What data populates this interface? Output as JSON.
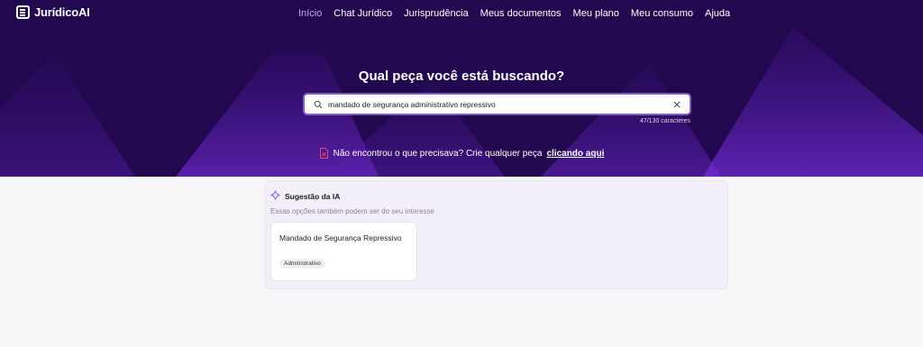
{
  "brand": {
    "name": "JurídicoAI"
  },
  "nav": {
    "items": [
      {
        "label": "Início",
        "active": true
      },
      {
        "label": "Chat Jurídico"
      },
      {
        "label": "Jurisprudência"
      },
      {
        "label": "Meus documentos"
      },
      {
        "label": "Meu plano"
      },
      {
        "label": "Meu consumo"
      },
      {
        "label": "Ajuda"
      }
    ]
  },
  "hero": {
    "title": "Qual peça você está buscando?",
    "search_value": "mandado de segurança administrativo repressivo",
    "char_counter": "47/130 caracteres",
    "notfound_text": "Não encontrou o que precisava? Crie qualquer peça",
    "notfound_link": "clicando aqui"
  },
  "suggestion": {
    "title": "Sugestão da IA",
    "subtitle": "Essas opções também podem ser do seu interesse",
    "cards": [
      {
        "title": "Mandado de Segurança Repressivo",
        "tag": "Administrativo"
      }
    ]
  },
  "colors": {
    "hero_bg": "#22084f",
    "accent": "#8b5cf6",
    "active_nav": "#c9a6ff",
    "doc_icon": "#e8456b"
  }
}
